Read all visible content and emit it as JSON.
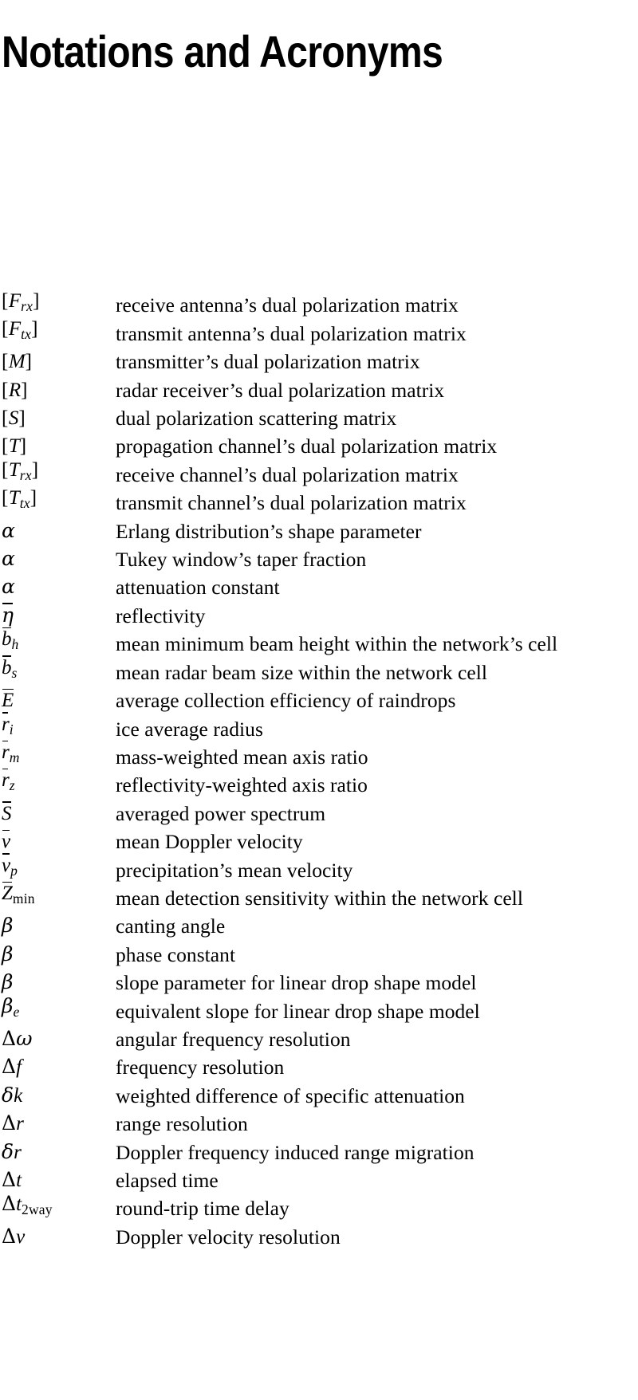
{
  "page": {
    "title": "Notations and Acronyms",
    "background_color": "#ffffff",
    "text_color": "#000000"
  },
  "glossary": {
    "rows": [
      {
        "symbol": "[F_rx]",
        "description": "receive antenna’s dual polarization matrix"
      },
      {
        "symbol": "[F_tx]",
        "description": "transmit antenna’s dual polarization matrix"
      },
      {
        "symbol": "[M]",
        "description": "transmitter’s dual polarization matrix"
      },
      {
        "symbol": "[R]",
        "description": "radar receiver’s dual polarization matrix"
      },
      {
        "symbol": "[S]",
        "description": "dual polarization scattering matrix"
      },
      {
        "symbol": "[T]",
        "description": "propagation channel’s dual polarization matrix"
      },
      {
        "symbol": "[T_rx]",
        "description": "receive channel’s dual polarization matrix"
      },
      {
        "symbol": "[T_tx]",
        "description": "transmit channel’s dual polarization matrix"
      },
      {
        "symbol": "α",
        "description": "Erlang distribution’s shape parameter"
      },
      {
        "symbol": "α",
        "description": "Tukey window’s taper fraction"
      },
      {
        "symbol": "α",
        "description": "attenuation constant"
      },
      {
        "symbol": "η̄",
        "description": "reflectivity"
      },
      {
        "symbol": "b̄_h",
        "description": "mean minimum beam height within the network’s cell"
      },
      {
        "symbol": "b̄_s",
        "description": "mean radar beam size within the network cell"
      },
      {
        "symbol": "Ē",
        "description": "average collection efficiency of raindrops"
      },
      {
        "symbol": "r̄_i",
        "description": "ice average radius"
      },
      {
        "symbol": "r̄_m",
        "description": "mass-weighted mean axis ratio"
      },
      {
        "symbol": "r̄_z",
        "description": "reflectivity-weighted axis ratio"
      },
      {
        "symbol": "S̄",
        "description": "averaged power spectrum"
      },
      {
        "symbol": "v̄",
        "description": "mean Doppler velocity"
      },
      {
        "symbol": "v̄_p",
        "description": "precipitation’s mean velocity"
      },
      {
        "symbol": "Z̄_min",
        "description": "mean detection sensitivity within the network cell"
      },
      {
        "symbol": "β",
        "description": "canting angle"
      },
      {
        "symbol": "β",
        "description": "phase constant"
      },
      {
        "symbol": "β",
        "description": "slope parameter for linear drop shape model"
      },
      {
        "symbol": "β_e",
        "description": "equivalent slope for linear drop shape model"
      },
      {
        "symbol": "Δω",
        "description": "angular frequency resolution"
      },
      {
        "symbol": "Δf",
        "description": "frequency resolution"
      },
      {
        "symbol": "δk",
        "description": "weighted difference of specific attenuation"
      },
      {
        "symbol": "Δr",
        "description": "range resolution"
      },
      {
        "symbol": "δr",
        "description": "Doppler frequency induced range migration"
      },
      {
        "symbol": "Δt",
        "description": "elapsed time"
      },
      {
        "symbol": "Δt_2way",
        "description": "round-trip time delay"
      },
      {
        "symbol": "Δv",
        "description": "Doppler velocity resolution"
      }
    ]
  }
}
